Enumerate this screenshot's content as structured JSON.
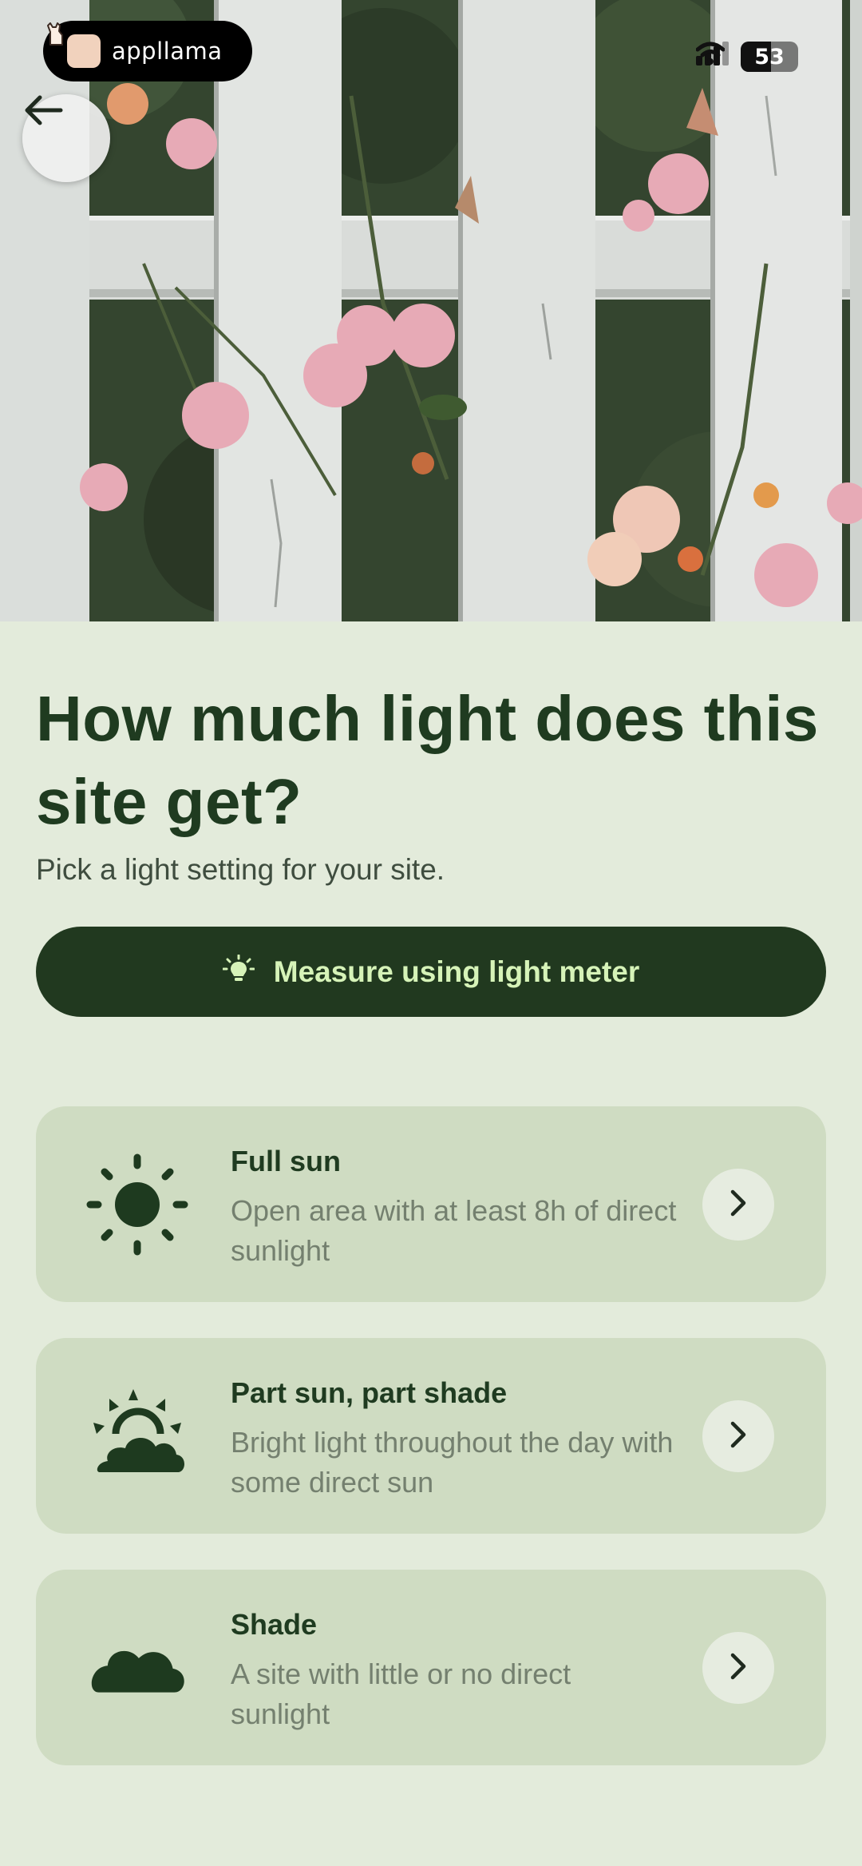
{
  "brand": {
    "name": "appllama"
  },
  "status_bar": {
    "battery": "53",
    "battery_level": 0.53
  },
  "page": {
    "title": "How much light does this site get?",
    "subtitle": "Pick a light setting for your site."
  },
  "meter_button": {
    "label": "Measure using light meter",
    "icon": "lightbulb-icon"
  },
  "options": [
    {
      "name": "Full sun",
      "description": "Open area with at least 8h of direct sunlight",
      "icon": "sun-icon"
    },
    {
      "name": "Part sun, part shade",
      "description": "Bright light throughout the day with some direct sun",
      "icon": "sun-behind-cloud-icon"
    },
    {
      "name": "Shade",
      "description": "A site with little or no direct sunlight",
      "icon": "cloud-icon"
    }
  ],
  "colors": {
    "background": "#e3ebdb",
    "primary_dark": "#21391f",
    "accent_text": "#d6f3b8",
    "card": "#cfdcc2"
  }
}
